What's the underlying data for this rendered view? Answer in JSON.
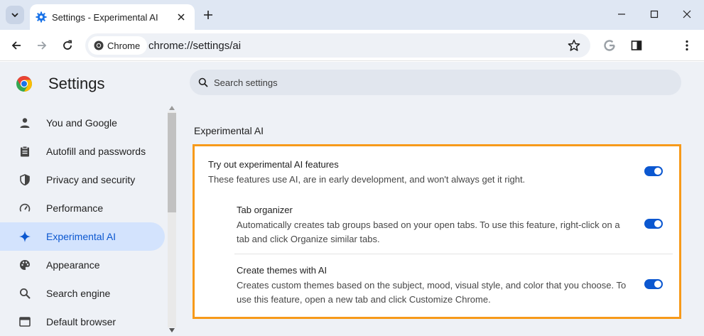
{
  "tab": {
    "title": "Settings - Experimental AI"
  },
  "toolbar": {
    "chip_label": "Chrome",
    "url": "chrome://settings/ai"
  },
  "settings": {
    "title": "Settings",
    "search_placeholder": "Search settings",
    "nav": [
      {
        "label": "You and Google",
        "icon": "person-icon"
      },
      {
        "label": "Autofill and passwords",
        "icon": "clipboard-icon"
      },
      {
        "label": "Privacy and security",
        "icon": "shield-icon"
      },
      {
        "label": "Performance",
        "icon": "speedometer-icon"
      },
      {
        "label": "Experimental AI",
        "icon": "sparkle-icon",
        "active": true
      },
      {
        "label": "Appearance",
        "icon": "palette-icon"
      },
      {
        "label": "Search engine",
        "icon": "search-icon"
      },
      {
        "label": "Default browser",
        "icon": "browser-icon"
      }
    ],
    "section_title": "Experimental AI",
    "main_toggle": {
      "title": "Try out experimental AI features",
      "desc": "These features use AI, are in early development, and won't always get it right.",
      "on": true
    },
    "tab_organizer": {
      "title": "Tab organizer",
      "desc_1": "Automatically creates tab groups based on your open tabs. To use this feature, right-click on a",
      "desc_2": "tab and click Organize similar tabs.",
      "on": true
    },
    "themes": {
      "title": "Create themes with AI",
      "desc_1": "Creates custom themes based on the subject, mood, visual style, and color that you choose. To",
      "desc_2": "use this feature, open a new tab and click Customize Chrome.",
      "on": true
    }
  },
  "colors": {
    "accent": "#0b57d0",
    "highlight": "#f79a1a",
    "page_bg": "#eef1f6"
  }
}
